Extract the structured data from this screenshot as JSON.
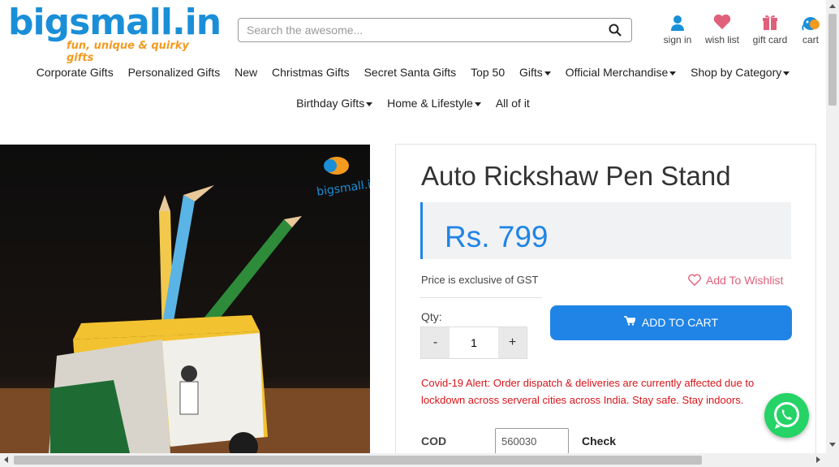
{
  "header": {
    "logo_text": "bigsmall.in",
    "logo_tagline": "fun, unique & quirky gifts",
    "search_placeholder": "Search the awesome...",
    "links": [
      {
        "label": "sign in",
        "icon": "user-icon",
        "color": "#1a8fd8"
      },
      {
        "label": "wish list",
        "icon": "heart-icon",
        "color": "#e0607a"
      },
      {
        "label": "gift card",
        "icon": "gift-icon",
        "color": "#e0607a"
      },
      {
        "label": "cart",
        "icon": "cart-elephant-icon",
        "color": "#1a8fd8"
      }
    ]
  },
  "nav": {
    "row1": [
      {
        "label": "Corporate Gifts",
        "dropdown": false
      },
      {
        "label": "Personalized Gifts",
        "dropdown": false
      },
      {
        "label": "New",
        "dropdown": false
      },
      {
        "label": "Christmas Gifts",
        "dropdown": false
      },
      {
        "label": "Secret Santa Gifts",
        "dropdown": false
      },
      {
        "label": "Top 50",
        "dropdown": false
      },
      {
        "label": "Gifts",
        "dropdown": true
      },
      {
        "label": "Official Merchandise",
        "dropdown": true
      },
      {
        "label": "Shop by Category",
        "dropdown": true
      }
    ],
    "row2": [
      {
        "label": "Birthday Gifts",
        "dropdown": true
      },
      {
        "label": "Home & Lifestyle",
        "dropdown": true
      },
      {
        "label": "All of it",
        "dropdown": false
      }
    ]
  },
  "product": {
    "image_watermark": "bigsmall.in",
    "title": "Auto Rickshaw Pen Stand",
    "price": "Rs. 799",
    "gst_note": "Price is exclusive of GST",
    "wishlist_label": "Add To Wishlist",
    "qty_label": "Qty:",
    "qty_value": "1",
    "qty_minus": "-",
    "qty_plus": "+",
    "add_to_cart_label": "ADD TO CART",
    "alert": "Covid-19 Alert: Order dispatch & deliveries are currently affected due to lockdown across serveral cities across India. Stay safe. Stay indoors.",
    "cod_label": "COD",
    "pincode_value": "560030",
    "check_label": "Check"
  },
  "colors": {
    "brand_blue": "#1f84e6",
    "brand_orange": "#f39a1f",
    "alert_red": "#d7141a",
    "whatsapp_green": "#25d366"
  }
}
